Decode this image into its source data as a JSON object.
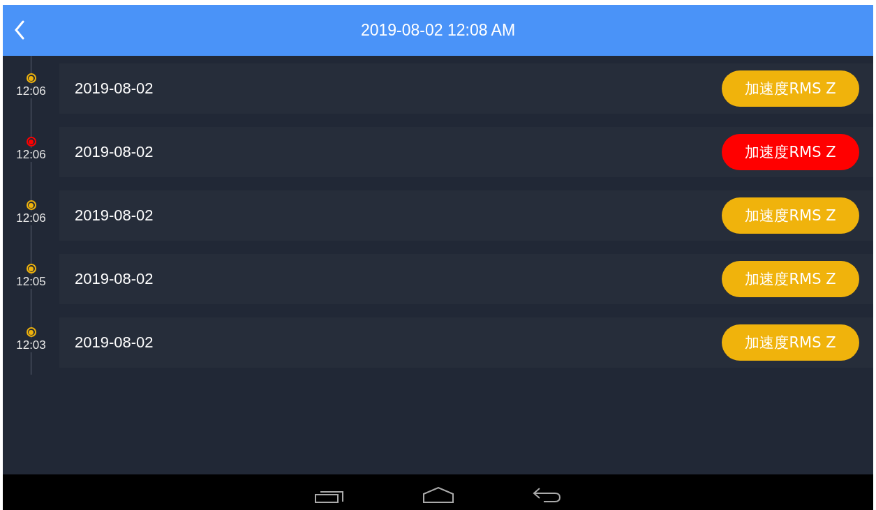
{
  "header": {
    "title": "2019-08-02 12:08 AM"
  },
  "events": [
    {
      "time": "12:06",
      "date": "2019-08-02",
      "tag": "加速度RMS Z",
      "color": "#f0b30c"
    },
    {
      "time": "12:06",
      "date": "2019-08-02",
      "tag": "加速度RMS Z",
      "color": "#ff0000"
    },
    {
      "time": "12:06",
      "date": "2019-08-02",
      "tag": "加速度RMS Z",
      "color": "#f0b30c"
    },
    {
      "time": "12:05",
      "date": "2019-08-02",
      "tag": "加速度RMS Z",
      "color": "#f0b30c"
    },
    {
      "time": "12:03",
      "date": "2019-08-02",
      "tag": "加速度RMS Z",
      "color": "#f0b30c"
    }
  ]
}
